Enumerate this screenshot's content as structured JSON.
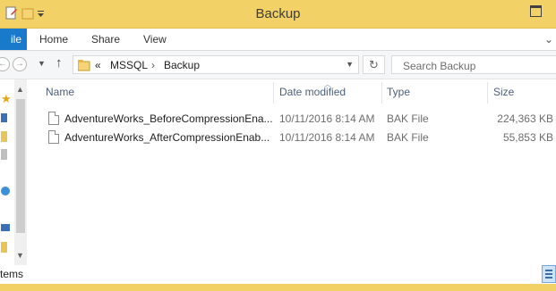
{
  "window": {
    "title": "Backup"
  },
  "ribbon": {
    "file_tab": "ile",
    "tabs": [
      "Home",
      "Share",
      "View"
    ]
  },
  "address": {
    "overflow": "«",
    "crumbs": [
      "MSSQL",
      "Backup"
    ]
  },
  "search": {
    "placeholder": "Search Backup"
  },
  "columns": {
    "name": "Name",
    "date_modified": "Date modified",
    "type": "Type",
    "size": "Size"
  },
  "files": [
    {
      "name": "AdventureWorks_BeforeCompressionEna...",
      "date": "10/11/2016 8:14 AM",
      "type": "BAK File",
      "size": "224,363 KB"
    },
    {
      "name": "AdventureWorks_AfterCompressionEnab...",
      "date": "10/11/2016 8:14 AM",
      "type": "BAK File",
      "size": "55,853 KB"
    }
  ],
  "status": {
    "text": "tems"
  },
  "colors": {
    "titlebar": "#f2d167",
    "file_tab": "#1979ca",
    "header_text": "#4c607a"
  },
  "icons": [
    "properties-icon",
    "new-folder-icon",
    "qat-dropdown-icon",
    "maximize-icon",
    "back-icon",
    "forward-icon",
    "recent-dropdown-icon",
    "up-arrow-icon",
    "folder-icon",
    "refresh-icon",
    "file-icon",
    "details-view-icon"
  ]
}
